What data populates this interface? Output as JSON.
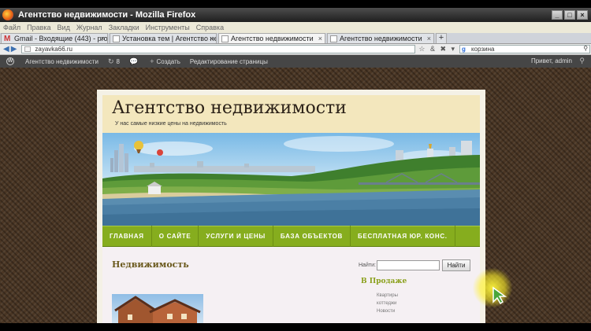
{
  "window": {
    "title": "Агентство недвижимости - Mozilla Firefox",
    "controls": [
      "_",
      "□",
      "×"
    ]
  },
  "menu": [
    "Файл",
    "Правка",
    "Вид",
    "Журнал",
    "Закладки",
    "Инструменты",
    "Справка"
  ],
  "tabs": [
    {
      "label": "Gmail - Входящие (443) - proka...",
      "icon": "gmail-icon",
      "active": false
    },
    {
      "label": "Установка тем | Агентство не...",
      "icon": "page-icon",
      "active": false
    },
    {
      "label": "Агентство недвижимости",
      "icon": "page-icon",
      "active": true
    },
    {
      "label": "Агентство недвижимости",
      "icon": "page-icon",
      "active": false
    }
  ],
  "new_tab": "+",
  "tab_close": "×",
  "nav": {
    "url": "zayavka66.ru",
    "search_value": "корзина",
    "url_icons": "☆ & ✖ ▾"
  },
  "adminbar": {
    "site": "Агентство недвижимости",
    "updates": "8",
    "create": "Создать",
    "edit": "Редактирование страницы",
    "greeting": "Привет, admin"
  },
  "site": {
    "title": "Агентство недвижимости",
    "description": "У нас самые низкие цены на недвижимость",
    "nav": [
      "ГЛАВНАЯ",
      "О САЙТЕ",
      "УСЛУГИ И ЦЕНЫ",
      "БАЗА ОБЪЕКТОВ",
      "БЕСПЛАТНАЯ ЮР. КОНС."
    ],
    "page_heading": "Недвижимость",
    "search_label": "Найти:",
    "search_button": "Найти",
    "widget_title": "В Продаже",
    "widget_items": [
      "Квартиры",
      "коттеджи",
      "Новости"
    ]
  },
  "colors": {
    "nav_green": "#86ad1e",
    "header_cream": "#f3e7bd",
    "page_brown": "#4a3624",
    "admin_bar": "#464646",
    "widget_title": "#8aa01b"
  }
}
